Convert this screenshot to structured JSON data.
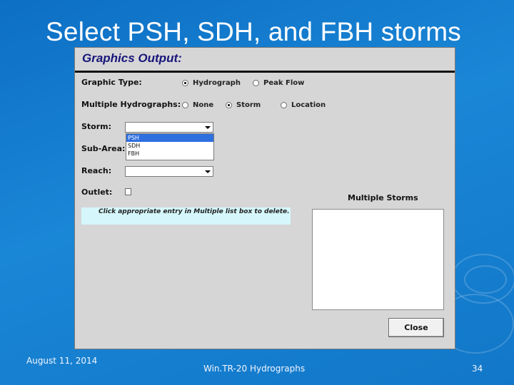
{
  "slide": {
    "title": "Select PSH, SDH, and FBH storms",
    "footer_date": "August 11, 2014",
    "footer_center": "Win.TR-20 Hydrographs",
    "page_number": "34"
  },
  "dialog": {
    "title": "Graphics Output:",
    "graphic_type": {
      "label": "Graphic Type:",
      "options": [
        "Hydrograph",
        "Peak Flow"
      ],
      "selected": "Hydrograph"
    },
    "multiple_hydrographs": {
      "label": "Multiple Hydrographs:",
      "options": [
        "None",
        "Storm",
        "Location"
      ],
      "selected": "Storm"
    },
    "storm": {
      "label": "Storm:",
      "value": "",
      "dropdown_items": [
        "PSH",
        "SDH",
        "FBH"
      ],
      "highlighted": "PSH"
    },
    "sub_area": {
      "label": "Sub-Area:"
    },
    "reach": {
      "label": "Reach:",
      "value": ""
    },
    "outlet": {
      "label": "Outlet:",
      "checked": false
    },
    "hint": "Click appropriate entry in Multiple list box to delete.",
    "multiple_storms": {
      "label": "Multiple Storms",
      "items": []
    },
    "close_label": "Close"
  },
  "colors": {
    "slide_background": "#1277c8",
    "dialog_background": "#d6d6d6",
    "dialog_title": "#17157a",
    "selection": "#2f6fe0",
    "hint_background": "#d5f7fb"
  }
}
